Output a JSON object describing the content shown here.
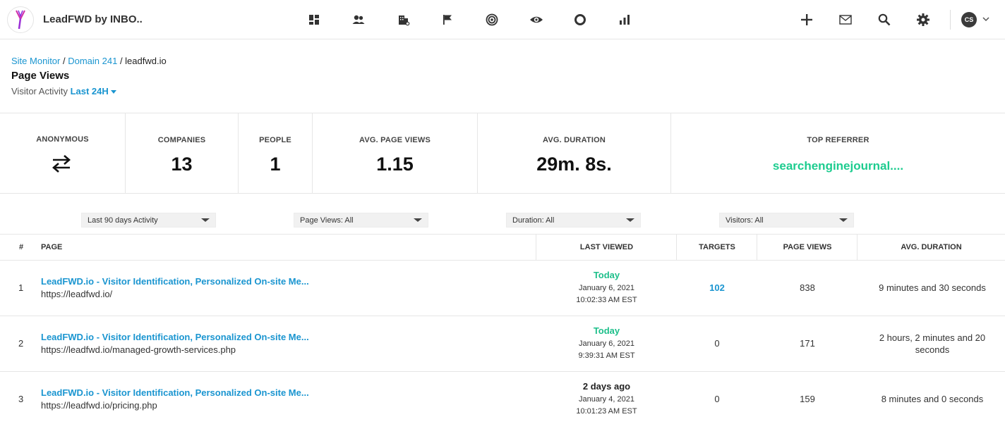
{
  "app": {
    "title": "LeadFWD by INBO.."
  },
  "nav_icons": [
    "dashboard-icon",
    "people-icon",
    "companies-icon",
    "flag-icon",
    "target-icon",
    "eye-icon",
    "circle-icon",
    "bar-chart-icon"
  ],
  "actions": {
    "avatar_initials": "CS"
  },
  "breadcrumb": {
    "items": [
      "Site Monitor",
      "Domain 241"
    ],
    "current": "leadfwd.io",
    "sep": " / "
  },
  "page": {
    "title": "Page Views",
    "subtitle_label": "Visitor Activity",
    "range": "Last 24H"
  },
  "stats": {
    "anonymous_label": "ANONYMOUS",
    "companies_label": "COMPANIES",
    "companies_value": "13",
    "people_label": "PEOPLE",
    "people_value": "1",
    "avg_pv_label": "AVG. PAGE VIEWS",
    "avg_pv_value": "1.15",
    "avg_dur_label": "AVG. DURATION",
    "avg_dur_value": "29m. 8s.",
    "referrer_label": "TOP REFERRER",
    "referrer_value": "searchenginejournal...."
  },
  "filters": {
    "activity": "Last 90 days Activity",
    "page_views": "Page Views: All",
    "duration": "Duration: All",
    "visitors": "Visitors: All"
  },
  "table": {
    "headers": {
      "num": "#",
      "page": "PAGE",
      "last_viewed": "LAST VIEWED",
      "targets": "TARGETS",
      "page_views": "PAGE VIEWS",
      "avg_duration": "AVG. DURATION"
    },
    "rows": [
      {
        "num": "1",
        "title": "LeadFWD.io - Visitor Identification, Personalized On-site Me...",
        "url": "https://leadfwd.io/",
        "rel": "Today",
        "date": "January 6, 2021",
        "time": "10:02:33 AM EST",
        "targets": "102",
        "page_views": "838",
        "duration": "9 minutes and 30 seconds"
      },
      {
        "num": "2",
        "title": "LeadFWD.io - Visitor Identification, Personalized On-site Me...",
        "url": "https://leadfwd.io/managed-growth-services.php",
        "rel": "Today",
        "date": "January 6, 2021",
        "time": "9:39:31 AM EST",
        "targets": "0",
        "page_views": "171",
        "duration": "2 hours, 2 minutes and 20 seconds"
      },
      {
        "num": "3",
        "title": "LeadFWD.io - Visitor Identification, Personalized On-site Me...",
        "url": "https://leadfwd.io/pricing.php",
        "rel": "2 days ago",
        "date": "January 4, 2021",
        "time": "10:01:23 AM EST",
        "targets": "0",
        "page_views": "159",
        "duration": "8 minutes and 0 seconds"
      }
    ]
  },
  "colors": {
    "link": "#1a95d0",
    "green": "#1dcc8f",
    "logo": "#9b2fd6"
  }
}
